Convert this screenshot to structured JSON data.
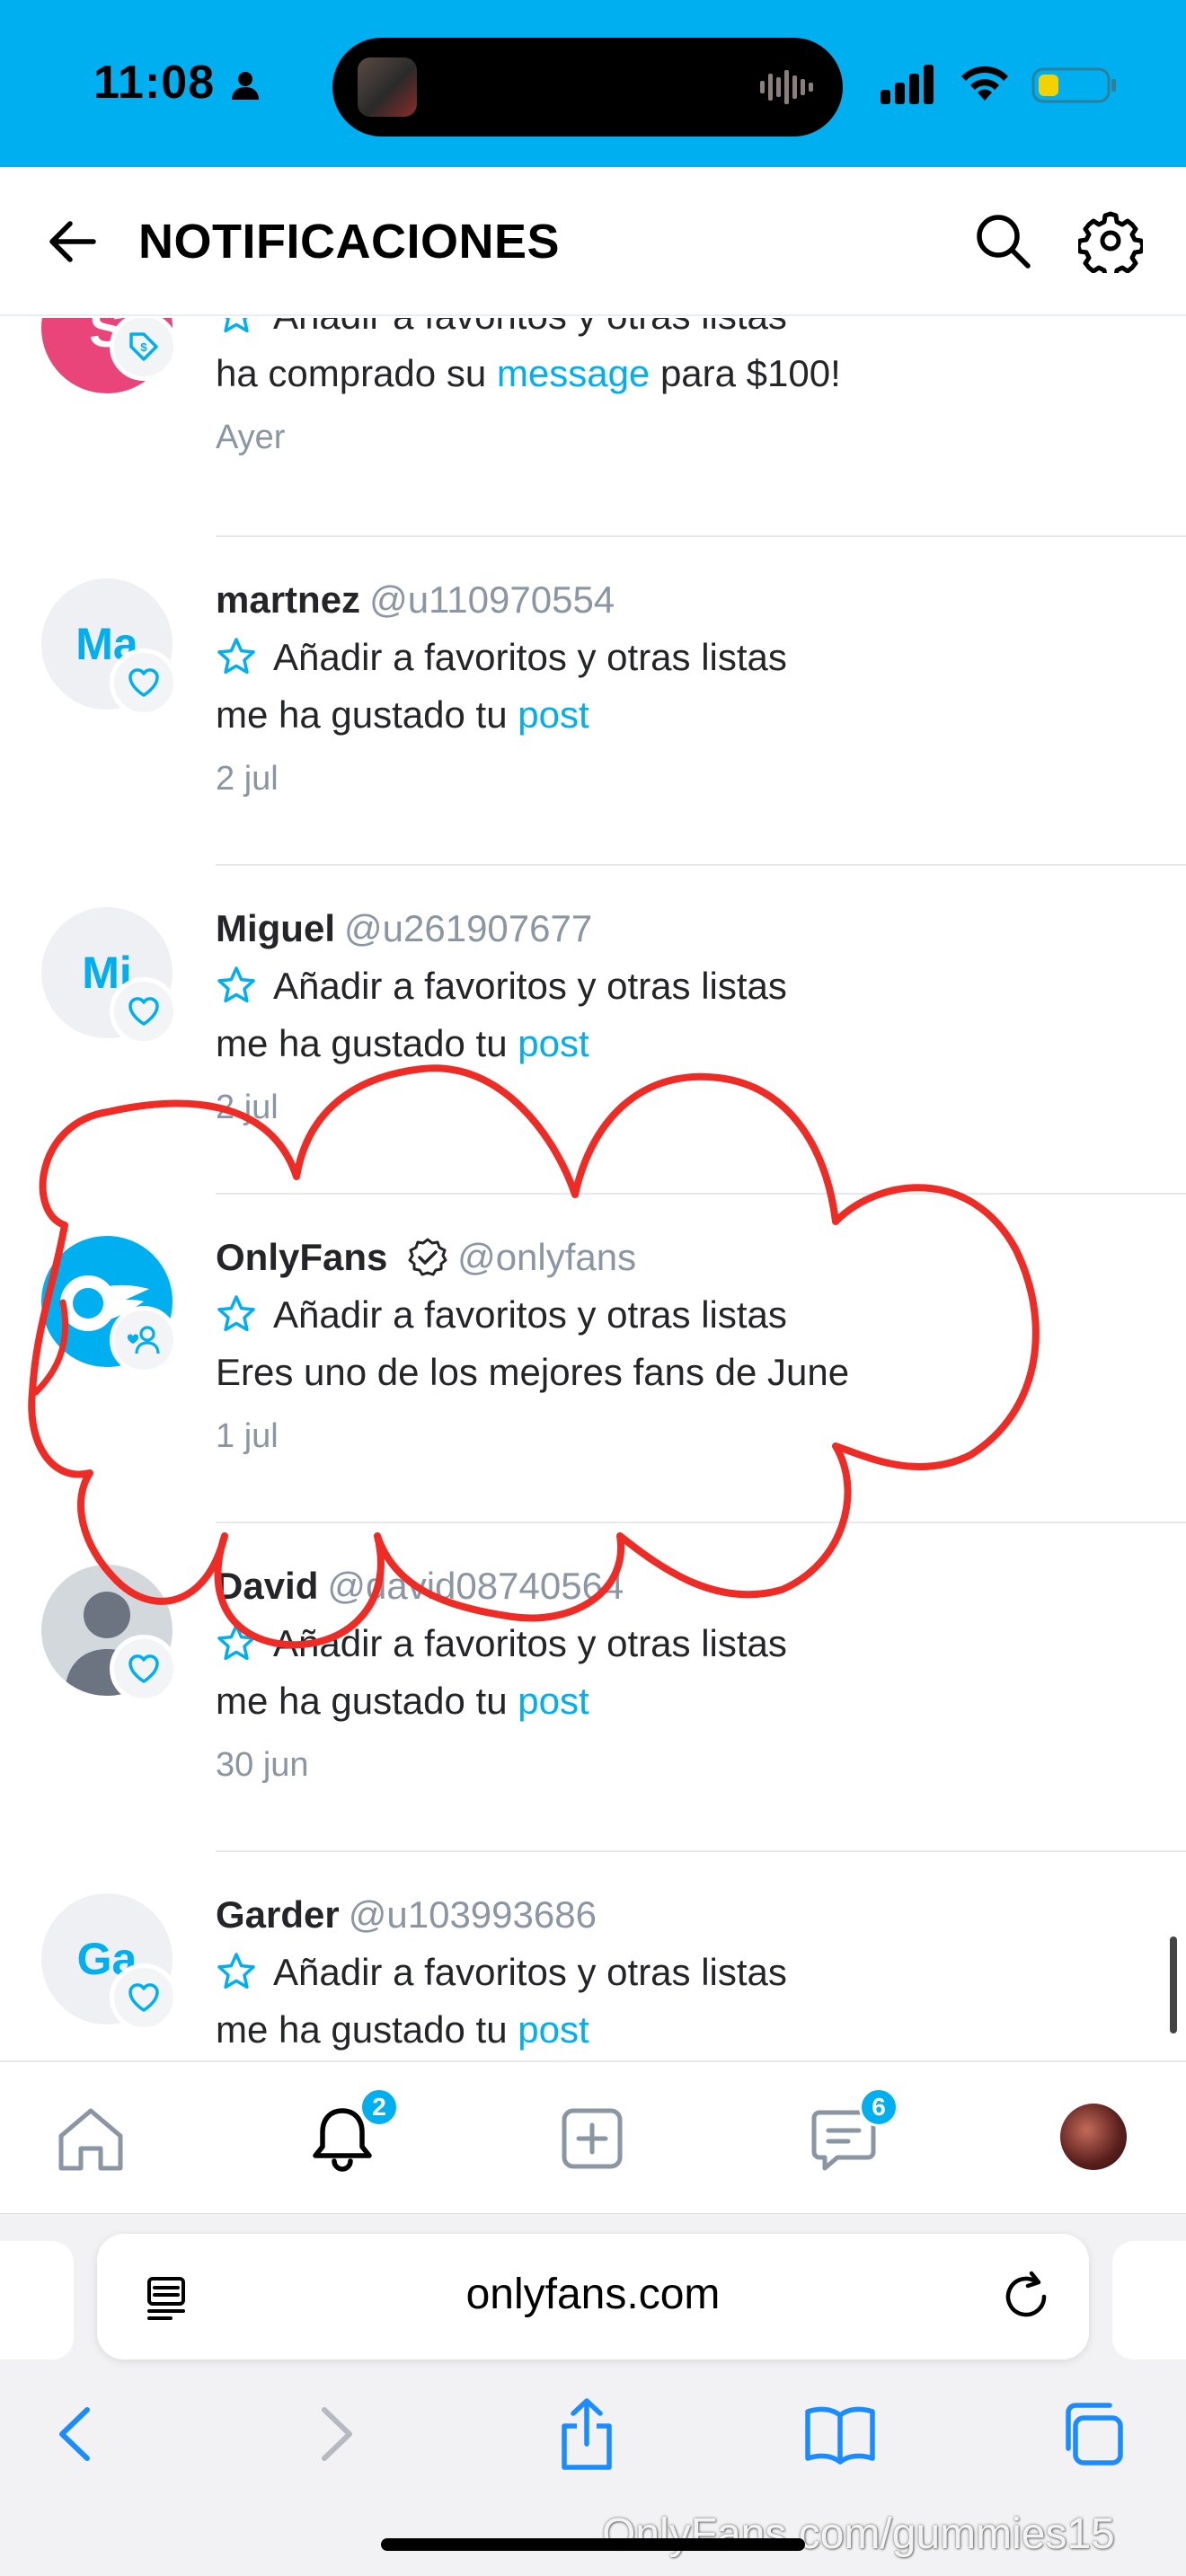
{
  "status_bar": {
    "time": "11:08",
    "accent": "#00aff0"
  },
  "header": {
    "title": "NOTIFICACIONES",
    "icons": [
      "back-arrow-icon",
      "search-icon",
      "gear-icon"
    ]
  },
  "notifications": [
    {
      "avatar_icon": "tag-icon",
      "name": "",
      "handle": "",
      "fav_label": "Añadir a favoritos y otras listas",
      "msg_before": "ha comprado su ",
      "msg_link": "message",
      "msg_after": " para $100!",
      "time": "Ayer"
    },
    {
      "initials": "Ma",
      "avatar_icon": "heart-icon",
      "name": "martnez",
      "handle": "@u110970554",
      "fav_label": "Añadir a favoritos y otras listas",
      "msg_before": "me ha gustado tu ",
      "msg_link": "post",
      "msg_after": "",
      "time": "2 jul"
    },
    {
      "initials": "Mi",
      "avatar_icon": "heart-icon",
      "name": "Miguel",
      "handle": "@u261907677",
      "fav_label": "Añadir a favoritos y otras listas",
      "msg_before": "me ha gustado tu ",
      "msg_link": "post",
      "msg_after": "",
      "time": "2 jul"
    },
    {
      "avatar_icon": "user-heart-icon",
      "name": "OnlyFans",
      "verified": true,
      "handle": "@onlyfans",
      "fav_label": "Añadir a favoritos y otras listas",
      "msg_before": "Eres uno de los mejores fans de June",
      "msg_link": "",
      "msg_after": "",
      "time": "1 jul"
    },
    {
      "avatar_icon": "heart-icon",
      "name": "David",
      "handle": "@david08740564",
      "fav_label": "Añadir a favoritos y otras listas",
      "msg_before": "me ha gustado tu ",
      "msg_link": "post",
      "msg_after": "",
      "time": "30 jun"
    },
    {
      "initials": "Ga",
      "avatar_icon": "heart-icon",
      "name": "Garder",
      "handle": "@u103993686",
      "fav_label": "Añadir a favoritos y otras listas",
      "msg_before": "me ha gustado tu ",
      "msg_link": "post",
      "msg_after": "",
      "time": ""
    }
  ],
  "bottom_nav": {
    "notifications_badge": "2",
    "messages_badge": "6",
    "items": [
      "home-icon",
      "bell-icon",
      "plus-square-icon",
      "chat-icon",
      "profile-avatar"
    ]
  },
  "browser": {
    "url": "onlyfans.com",
    "toolbar": [
      "back-icon",
      "forward-icon",
      "share-icon",
      "bookmarks-icon",
      "tabs-icon"
    ]
  },
  "watermark": "OnlyFans.com/gummies15",
  "annotation": {
    "color": "#ee2b24",
    "shape": "hand-drawn cloud outline around OnlyFans notification"
  }
}
